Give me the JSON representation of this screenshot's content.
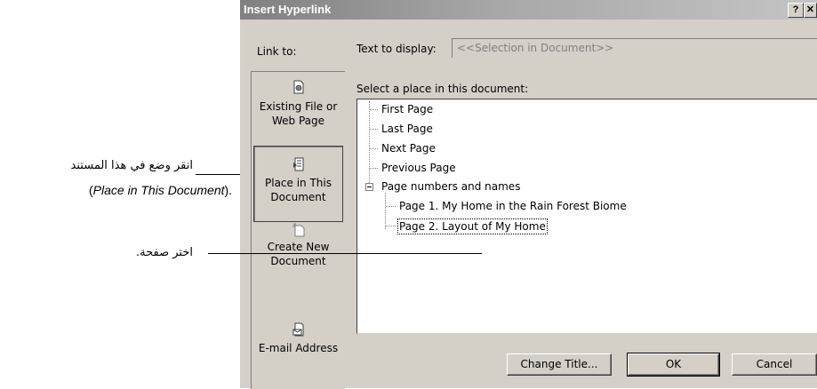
{
  "callouts": {
    "place_ar": "انقر وضع في هذا المستند",
    "place_en_prefix": "(",
    "place_en_italic": "Place in This Document",
    "place_en_suffix": ").",
    "choose_page_ar": "اختر صفحة."
  },
  "dialog": {
    "title": "Insert Hyperlink",
    "help_btn": "?",
    "close_btn": "✕",
    "link_to_label": "Link to:",
    "text_to_display_label": "Text to display:",
    "text_to_display_value": "<<Selection in Document>>",
    "select_place_label": "Select a place in this document:",
    "link_targets": {
      "existing_line1": "Existing File or",
      "existing_line2": "Web Page",
      "place_line1": "Place in This",
      "place_line2": "Document",
      "create_line1": "Create New",
      "create_line2": "Document",
      "email": "E-mail Address"
    },
    "tree": {
      "first": "First Page",
      "last": "Last Page",
      "next": "Next Page",
      "previous": "Previous Page",
      "page_names": "Page numbers and names",
      "page1": "Page 1. My Home in the Rain Forest Biome",
      "page2": "Page 2. Layout of My Home"
    },
    "buttons": {
      "change_title": "Change Title...",
      "ok": "OK",
      "cancel": "Cancel"
    }
  },
  "icons": {
    "existing": "document-globe-icon",
    "place": "document-page-icon",
    "create": "new-document-icon",
    "email": "email-envelope-icon"
  }
}
